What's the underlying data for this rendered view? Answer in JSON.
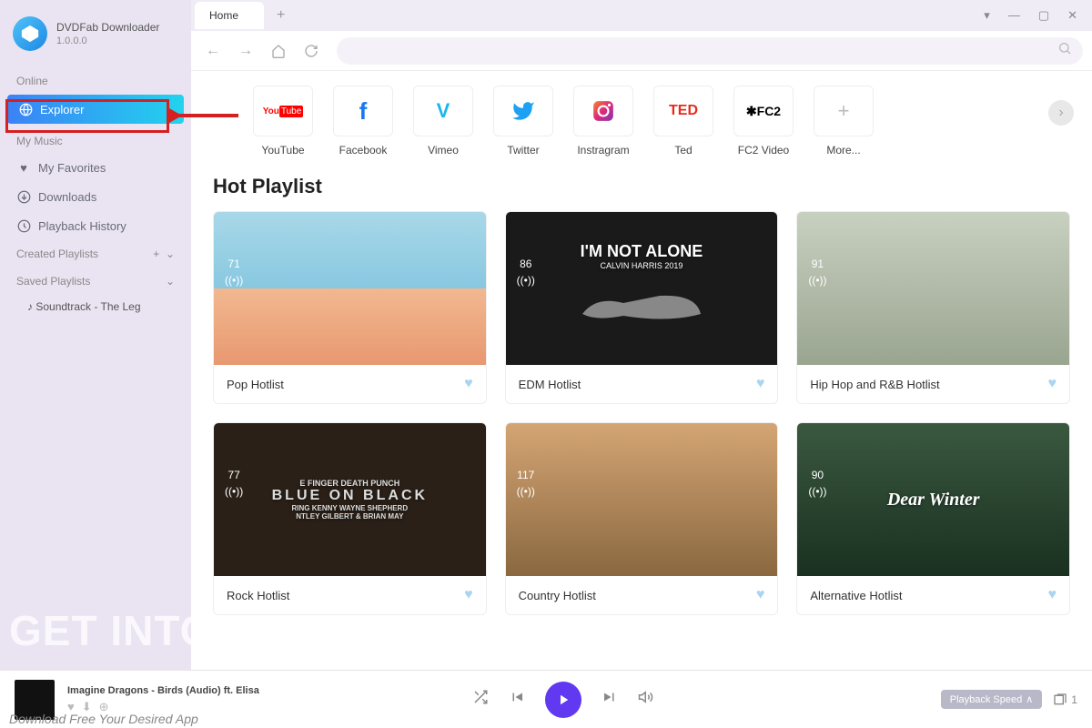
{
  "app": {
    "name": "DVDFab Downloader",
    "version": "1.0.0.0"
  },
  "sidebar": {
    "section_online": "Online",
    "explorer": "Explorer",
    "section_mymusic": "My Music",
    "favorites": "My Favorites",
    "downloads": "Downloads",
    "history": "Playback History",
    "created_pl": "Created Playlists",
    "saved_pl": "Saved Playlists",
    "saved_item": "Soundtrack - The Leg"
  },
  "tabs": {
    "home": "Home"
  },
  "sites": [
    {
      "label": "YouTube"
    },
    {
      "label": "Facebook"
    },
    {
      "label": "Vimeo"
    },
    {
      "label": "Twitter"
    },
    {
      "label": "Instragram"
    },
    {
      "label": "Ted"
    },
    {
      "label": "FC2 Video"
    },
    {
      "label": "More..."
    }
  ],
  "hot_playlist_title": "Hot Playlist",
  "cards": [
    {
      "title": "Pop Hotlist",
      "stat": "71"
    },
    {
      "title": "EDM Hotlist",
      "stat": "86",
      "overlay": "I'M NOT ALONE",
      "sub": "CALVIN HARRIS    2019"
    },
    {
      "title": "Hip Hop and R&B Hotlist",
      "stat": "91"
    },
    {
      "title": "Rock Hotlist",
      "stat": "77",
      "overlay": "BLUE ON BLACK",
      "sup": "E FINGER DEATH PUNCH",
      "sub": "RING KENNY WAYNE SHEPHERD\nNTLEY GILBERT & BRIAN MAY"
    },
    {
      "title": "Country Hotlist",
      "stat": "117"
    },
    {
      "title": "Alternative Hotlist",
      "stat": "90",
      "overlay": "Dear Winter"
    }
  ],
  "player": {
    "track": "Imagine Dragons - Birds (Audio) ft. Elisa",
    "speed_label": "Playback Speed",
    "queue_count": "1"
  },
  "watermark": {
    "big": "GET INTO PC",
    "small": "Download Free Your Desired App"
  },
  "site_logos": {
    "ted": "TED",
    "fc2": "✱FC2"
  }
}
